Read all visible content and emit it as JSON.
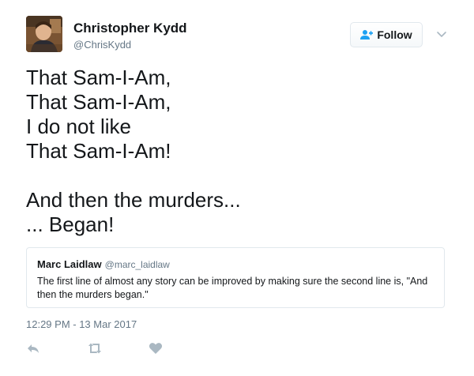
{
  "author": {
    "name": "Christopher Kydd",
    "handle": "@ChrisKydd"
  },
  "follow_button": {
    "label": "Follow",
    "icon": "follow-person-icon"
  },
  "menu": {
    "icon": "chevron-down-icon"
  },
  "tweet": {
    "lines": [
      "That Sam-I-Am,",
      "That Sam-I-Am,",
      "I do not like",
      "That Sam-I-Am!",
      "",
      "And then the murders...",
      "... Began!"
    ]
  },
  "quoted_tweet": {
    "name": "Marc Laidlaw",
    "handle": "@marc_laidlaw",
    "text": "The first line of almost any story can be improved by making sure the second line is, \"And then the murders began.\""
  },
  "timestamp": "12:29 PM - 13 Mar 2017",
  "actions": {
    "reply_icon": "reply-icon",
    "retweet_icon": "retweet-icon",
    "like_icon": "heart-icon"
  },
  "colors": {
    "text": "#14171a",
    "secondary_text": "#657786",
    "accent": "#1da1f2",
    "border": "#e1e8ed",
    "action_icon": "#aab8c2"
  }
}
